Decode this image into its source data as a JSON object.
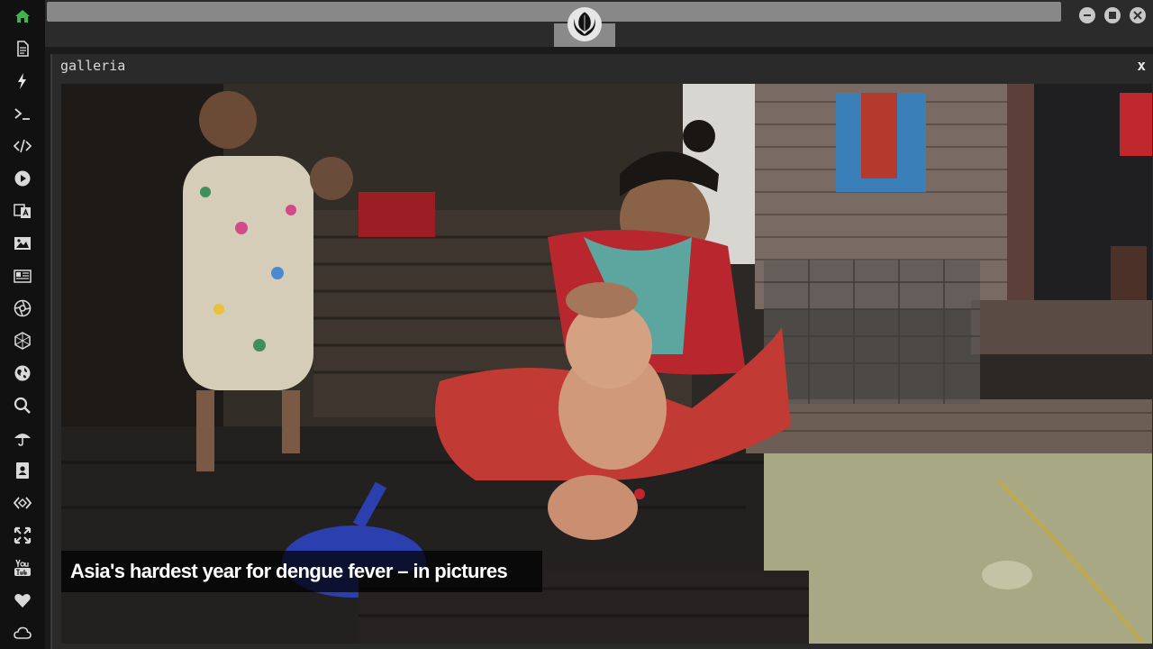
{
  "colors": {
    "sidebar_bg": "#111111",
    "accent_green": "#3bb84a",
    "icon_color": "#d9d9d9"
  },
  "sidebar": {
    "items": [
      {
        "icon": "home-icon"
      },
      {
        "icon": "document-icon"
      },
      {
        "icon": "lightning-icon"
      },
      {
        "icon": "terminal-icon"
      },
      {
        "icon": "code-icon"
      },
      {
        "icon": "play-icon"
      },
      {
        "icon": "translate-icon"
      },
      {
        "icon": "image-icon"
      },
      {
        "icon": "news-icon"
      },
      {
        "icon": "aperture-icon"
      },
      {
        "icon": "hexagon-icon"
      },
      {
        "icon": "globe-icon"
      },
      {
        "icon": "search-icon"
      },
      {
        "icon": "umbrella-icon"
      },
      {
        "icon": "contact-icon"
      },
      {
        "icon": "embed-icon"
      },
      {
        "icon": "expand-icon"
      },
      {
        "icon": "youtube-icon"
      },
      {
        "icon": "heart-icon"
      },
      {
        "icon": "cloud-icon"
      }
    ]
  },
  "window": {
    "title": "galleria",
    "close_label": "x"
  },
  "gallery": {
    "caption": "Asia's hardest year for dengue fever – in pictures"
  }
}
